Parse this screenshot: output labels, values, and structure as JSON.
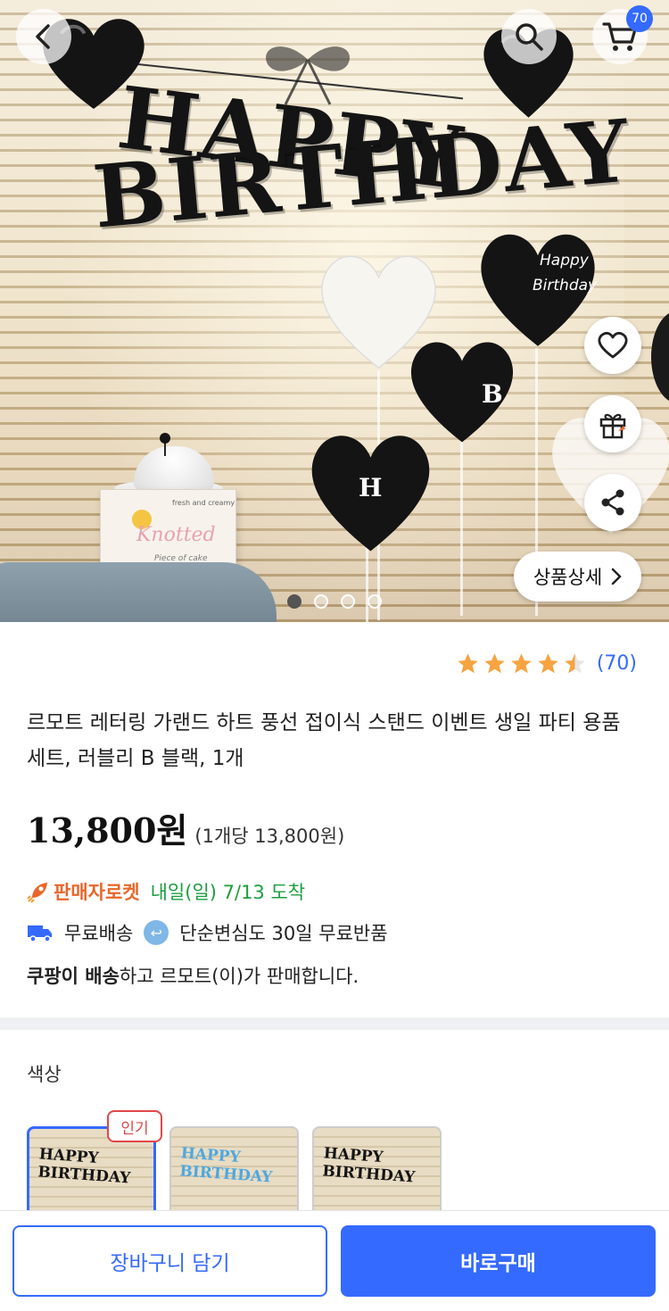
{
  "header": {
    "back_icon": "chevron-left-icon",
    "search_icon": "search-icon",
    "cart_icon": "cart-icon",
    "cart_count": "70"
  },
  "hero": {
    "banner_line1": "HAPPY",
    "banner_line2": "BIRTHDAY",
    "balloon_text_1": "Happy",
    "balloon_text_2": "Birthday",
    "balloon_letter_b": "B",
    "balloon_letter_h": "H",
    "cake_box_brand": "Knotted",
    "cake_box_tag1": "fresh and creamy",
    "cake_box_tag2": "Piece of cake",
    "detail_button_label": "상품상세",
    "slide_count": 4,
    "active_slide": 1
  },
  "side_actions": {
    "wishlist_icon": "heart-icon",
    "gift_icon": "gift-icon",
    "share_icon": "share-icon"
  },
  "rating": {
    "score": 4.5,
    "max": 5,
    "review_count": "(70)"
  },
  "product": {
    "title": "르모트 레터링 가랜드 하트 풍선 접이식 스탠드 이벤트 생일 파티 용품 세트, 러블리 B 블랙, 1개",
    "price": "13,800원",
    "unit_price": "(1개당 13,800원)"
  },
  "delivery": {
    "rocket_label": "판매자로켓",
    "arrival": "내일(일) 7/13 도착",
    "free_shipping": "무료배송",
    "free_return": "단순변심도 30일 무료반품",
    "seller_bold": "쿠팡이 배송",
    "seller_rest": "하고 르모트(이)가 판매합니다."
  },
  "options": {
    "label": "색상",
    "popular_badge": "인기",
    "thumbs": [
      {
        "line1": "HAPPY",
        "line2": "BIRTHDAY",
        "style": "black"
      },
      {
        "line1": "HAPPY",
        "line2": "BIRTHDAY",
        "style": "blue"
      },
      {
        "line1": "HAPPY",
        "line2": "BIRTHDAY",
        "style": "black-white"
      }
    ]
  },
  "bottom_bar": {
    "add_to_cart": "장바구니 담기",
    "buy_now": "바로구매"
  },
  "colors": {
    "accent": "#346aff",
    "rocket": "#e8672a",
    "arrival": "#1d9e3f",
    "star": "#f6a340",
    "badge": "#e0484a"
  }
}
